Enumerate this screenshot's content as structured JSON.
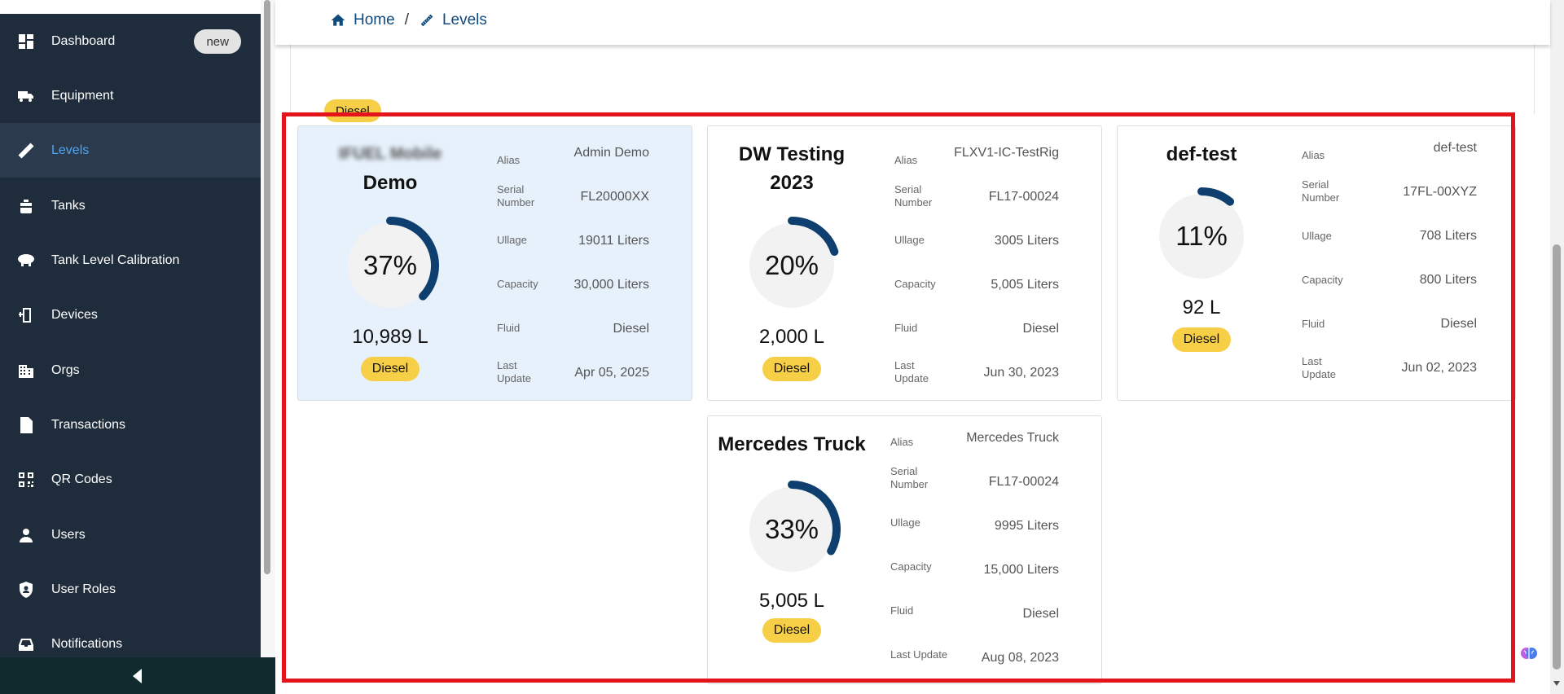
{
  "sidebar": {
    "items": [
      {
        "label": "Dashboard",
        "icon": "dashboard-icon",
        "badge": "new"
      },
      {
        "label": "Equipment",
        "icon": "truck-icon"
      },
      {
        "label": "Levels",
        "icon": "ruler-icon",
        "active": true
      },
      {
        "label": "Tanks",
        "icon": "tank-icon"
      },
      {
        "label": "Tank Level Calibration",
        "icon": "blimp-tank-icon"
      },
      {
        "label": "Devices",
        "icon": "device-icon"
      },
      {
        "label": "Orgs",
        "icon": "building-icon"
      },
      {
        "label": "Transactions",
        "icon": "receipt-icon"
      },
      {
        "label": "QR Codes",
        "icon": "qr-code-icon"
      },
      {
        "label": "Users",
        "icon": "user-icon"
      },
      {
        "label": "User Roles",
        "icon": "shield-user-icon"
      },
      {
        "label": "Notifications",
        "icon": "inbox-icon"
      }
    ],
    "collapse_icon": "chevron-left-icon"
  },
  "breadcrumb": {
    "home": "Home",
    "separator": "/",
    "current": "Levels"
  },
  "filter": {
    "chip": "Diesel"
  },
  "colors": {
    "sidebar_bg": "#1f2c3b",
    "active_text": "#4fa3f7",
    "gauge_arc": "#0f3f6e",
    "fluid_chip": "#f7cf46",
    "highlight": "#e3141b",
    "selected_card": "#e6f1fb"
  },
  "tanks": [
    {
      "name_line1": "IFUEL Mobile",
      "name_line2": "Demo",
      "percent": "37%",
      "fill_fraction": 0.37,
      "volume": "10,989 L",
      "fluid_chip": "Diesel",
      "labels": {
        "alias": "Alias",
        "serial": "Serial Number",
        "ullage": "Ullage",
        "capacity": "Capacity",
        "fluid": "Fluid",
        "last_update": "Last Update"
      },
      "alias": "Admin Demo",
      "serial": "FL20000XX",
      "ullage": "19011 Liters",
      "capacity": "30,000 Liters",
      "fluid": "Diesel",
      "last_update": "Apr 05, 2025"
    },
    {
      "name_line1": "DW Testing",
      "name_line2": "2023",
      "percent": "20%",
      "fill_fraction": 0.2,
      "volume": "2,000 L",
      "fluid_chip": "Diesel",
      "labels": {
        "alias": "Alias",
        "serial": "Serial Number",
        "ullage": "Ullage",
        "capacity": "Capacity",
        "fluid": "Fluid",
        "last_update": "Last Update"
      },
      "alias": "FLXV1-IC-TestRig",
      "serial": "FL17-00024",
      "ullage": "3005 Liters",
      "capacity": "5,005 Liters",
      "fluid": "Diesel",
      "last_update": "Jun 30, 2023"
    },
    {
      "name_line1": "def-test",
      "name_line2": "",
      "percent": "11%",
      "fill_fraction": 0.11,
      "volume": "92 L",
      "fluid_chip": "Diesel",
      "labels": {
        "alias": "Alias",
        "serial": "Serial Number",
        "ullage": "Ullage",
        "capacity": "Capacity",
        "fluid": "Fluid",
        "last_update": "Last Update"
      },
      "alias": "def-test",
      "serial": "17FL-00XYZ",
      "ullage": "708 Liters",
      "capacity": "800 Liters",
      "fluid": "Diesel",
      "last_update": "Jun 02, 2023"
    },
    {
      "name_line1": "Mercedes Truck",
      "name_line2": "",
      "percent": "33%",
      "fill_fraction": 0.33,
      "volume": "5,005 L",
      "fluid_chip": "Diesel",
      "labels": {
        "alias": "Alias",
        "serial": "Serial Number",
        "ullage": "Ullage",
        "capacity": "Capacity",
        "fluid": "Fluid",
        "last_update": "Last Update"
      },
      "alias": "Mercedes Truck",
      "serial": "FL17-00024",
      "ullage": "9995 Liters",
      "capacity": "15,000 Liters",
      "fluid": "Diesel",
      "last_update": "Aug 08, 2023"
    }
  ]
}
